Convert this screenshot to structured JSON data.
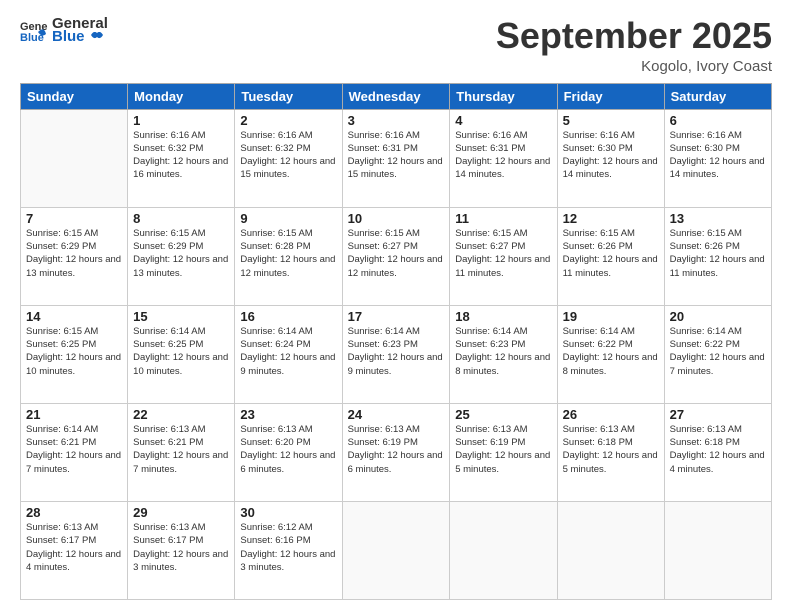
{
  "logo": {
    "text_general": "General",
    "text_blue": "Blue"
  },
  "header": {
    "month_title": "September 2025",
    "location": "Kogolo, Ivory Coast"
  },
  "weekdays": [
    "Sunday",
    "Monday",
    "Tuesday",
    "Wednesday",
    "Thursday",
    "Friday",
    "Saturday"
  ],
  "weeks": [
    [
      {
        "day": "",
        "sunrise": "",
        "sunset": "",
        "daylight": ""
      },
      {
        "day": "1",
        "sunrise": "Sunrise: 6:16 AM",
        "sunset": "Sunset: 6:32 PM",
        "daylight": "Daylight: 12 hours and 16 minutes."
      },
      {
        "day": "2",
        "sunrise": "Sunrise: 6:16 AM",
        "sunset": "Sunset: 6:32 PM",
        "daylight": "Daylight: 12 hours and 15 minutes."
      },
      {
        "day": "3",
        "sunrise": "Sunrise: 6:16 AM",
        "sunset": "Sunset: 6:31 PM",
        "daylight": "Daylight: 12 hours and 15 minutes."
      },
      {
        "day": "4",
        "sunrise": "Sunrise: 6:16 AM",
        "sunset": "Sunset: 6:31 PM",
        "daylight": "Daylight: 12 hours and 14 minutes."
      },
      {
        "day": "5",
        "sunrise": "Sunrise: 6:16 AM",
        "sunset": "Sunset: 6:30 PM",
        "daylight": "Daylight: 12 hours and 14 minutes."
      },
      {
        "day": "6",
        "sunrise": "Sunrise: 6:16 AM",
        "sunset": "Sunset: 6:30 PM",
        "daylight": "Daylight: 12 hours and 14 minutes."
      }
    ],
    [
      {
        "day": "7",
        "sunrise": "Sunrise: 6:15 AM",
        "sunset": "Sunset: 6:29 PM",
        "daylight": "Daylight: 12 hours and 13 minutes."
      },
      {
        "day": "8",
        "sunrise": "Sunrise: 6:15 AM",
        "sunset": "Sunset: 6:29 PM",
        "daylight": "Daylight: 12 hours and 13 minutes."
      },
      {
        "day": "9",
        "sunrise": "Sunrise: 6:15 AM",
        "sunset": "Sunset: 6:28 PM",
        "daylight": "Daylight: 12 hours and 12 minutes."
      },
      {
        "day": "10",
        "sunrise": "Sunrise: 6:15 AM",
        "sunset": "Sunset: 6:27 PM",
        "daylight": "Daylight: 12 hours and 12 minutes."
      },
      {
        "day": "11",
        "sunrise": "Sunrise: 6:15 AM",
        "sunset": "Sunset: 6:27 PM",
        "daylight": "Daylight: 12 hours and 11 minutes."
      },
      {
        "day": "12",
        "sunrise": "Sunrise: 6:15 AM",
        "sunset": "Sunset: 6:26 PM",
        "daylight": "Daylight: 12 hours and 11 minutes."
      },
      {
        "day": "13",
        "sunrise": "Sunrise: 6:15 AM",
        "sunset": "Sunset: 6:26 PM",
        "daylight": "Daylight: 12 hours and 11 minutes."
      }
    ],
    [
      {
        "day": "14",
        "sunrise": "Sunrise: 6:15 AM",
        "sunset": "Sunset: 6:25 PM",
        "daylight": "Daylight: 12 hours and 10 minutes."
      },
      {
        "day": "15",
        "sunrise": "Sunrise: 6:14 AM",
        "sunset": "Sunset: 6:25 PM",
        "daylight": "Daylight: 12 hours and 10 minutes."
      },
      {
        "day": "16",
        "sunrise": "Sunrise: 6:14 AM",
        "sunset": "Sunset: 6:24 PM",
        "daylight": "Daylight: 12 hours and 9 minutes."
      },
      {
        "day": "17",
        "sunrise": "Sunrise: 6:14 AM",
        "sunset": "Sunset: 6:23 PM",
        "daylight": "Daylight: 12 hours and 9 minutes."
      },
      {
        "day": "18",
        "sunrise": "Sunrise: 6:14 AM",
        "sunset": "Sunset: 6:23 PM",
        "daylight": "Daylight: 12 hours and 8 minutes."
      },
      {
        "day": "19",
        "sunrise": "Sunrise: 6:14 AM",
        "sunset": "Sunset: 6:22 PM",
        "daylight": "Daylight: 12 hours and 8 minutes."
      },
      {
        "day": "20",
        "sunrise": "Sunrise: 6:14 AM",
        "sunset": "Sunset: 6:22 PM",
        "daylight": "Daylight: 12 hours and 7 minutes."
      }
    ],
    [
      {
        "day": "21",
        "sunrise": "Sunrise: 6:14 AM",
        "sunset": "Sunset: 6:21 PM",
        "daylight": "Daylight: 12 hours and 7 minutes."
      },
      {
        "day": "22",
        "sunrise": "Sunrise: 6:13 AM",
        "sunset": "Sunset: 6:21 PM",
        "daylight": "Daylight: 12 hours and 7 minutes."
      },
      {
        "day": "23",
        "sunrise": "Sunrise: 6:13 AM",
        "sunset": "Sunset: 6:20 PM",
        "daylight": "Daylight: 12 hours and 6 minutes."
      },
      {
        "day": "24",
        "sunrise": "Sunrise: 6:13 AM",
        "sunset": "Sunset: 6:19 PM",
        "daylight": "Daylight: 12 hours and 6 minutes."
      },
      {
        "day": "25",
        "sunrise": "Sunrise: 6:13 AM",
        "sunset": "Sunset: 6:19 PM",
        "daylight": "Daylight: 12 hours and 5 minutes."
      },
      {
        "day": "26",
        "sunrise": "Sunrise: 6:13 AM",
        "sunset": "Sunset: 6:18 PM",
        "daylight": "Daylight: 12 hours and 5 minutes."
      },
      {
        "day": "27",
        "sunrise": "Sunrise: 6:13 AM",
        "sunset": "Sunset: 6:18 PM",
        "daylight": "Daylight: 12 hours and 4 minutes."
      }
    ],
    [
      {
        "day": "28",
        "sunrise": "Sunrise: 6:13 AM",
        "sunset": "Sunset: 6:17 PM",
        "daylight": "Daylight: 12 hours and 4 minutes."
      },
      {
        "day": "29",
        "sunrise": "Sunrise: 6:13 AM",
        "sunset": "Sunset: 6:17 PM",
        "daylight": "Daylight: 12 hours and 3 minutes."
      },
      {
        "day": "30",
        "sunrise": "Sunrise: 6:12 AM",
        "sunset": "Sunset: 6:16 PM",
        "daylight": "Daylight: 12 hours and 3 minutes."
      },
      {
        "day": "",
        "sunrise": "",
        "sunset": "",
        "daylight": ""
      },
      {
        "day": "",
        "sunrise": "",
        "sunset": "",
        "daylight": ""
      },
      {
        "day": "",
        "sunrise": "",
        "sunset": "",
        "daylight": ""
      },
      {
        "day": "",
        "sunrise": "",
        "sunset": "",
        "daylight": ""
      }
    ]
  ]
}
